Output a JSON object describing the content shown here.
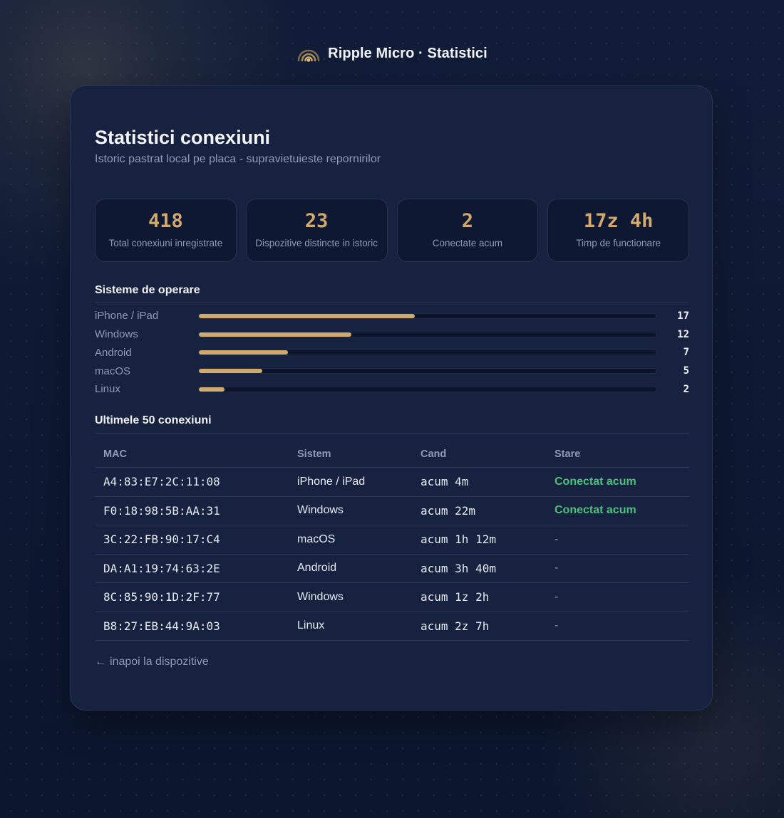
{
  "brand": {
    "title": "Ripple Micro · Statistici",
    "icon": "signal-waves-icon",
    "accent": "#d2ab6c"
  },
  "page": {
    "title": "Statistici conexiuni",
    "subtitle": "Istoric pastrat local pe placa - supravietuieste repornirilor"
  },
  "stats": [
    {
      "value": "418",
      "label": "Total conexiuni inregistrate"
    },
    {
      "value": "23",
      "label": "Dispozitive distincte in istoric"
    },
    {
      "value": "2",
      "label": "Conectate acum"
    },
    {
      "value": "17z 4h",
      "label": "Timp de functionare"
    }
  ],
  "os_section": {
    "title": "Sisteme de operare",
    "max": 36,
    "items": [
      {
        "name": "iPhone / iPad",
        "count": 17
      },
      {
        "name": "Windows",
        "count": 12
      },
      {
        "name": "Android",
        "count": 7
      },
      {
        "name": "macOS",
        "count": 5
      },
      {
        "name": "Linux",
        "count": 2
      }
    ]
  },
  "connections": {
    "title": "Ultimele 50 conexiuni",
    "headers": [
      "MAC",
      "Sistem",
      "Cand",
      "Stare"
    ],
    "rows": [
      {
        "mac": "A4:83:E7:2C:11:08",
        "os": "iPhone / iPad",
        "when": "acum 4m",
        "status": "Conectat acum",
        "online": true
      },
      {
        "mac": "F0:18:98:5B:AA:31",
        "os": "Windows",
        "when": "acum 22m",
        "status": "Conectat acum",
        "online": true
      },
      {
        "mac": "3C:22:FB:90:17:C4",
        "os": "macOS",
        "when": "acum 1h 12m",
        "status": "-",
        "online": false
      },
      {
        "mac": "DA:A1:19:74:63:2E",
        "os": "Android",
        "when": "acum 3h 40m",
        "status": "-",
        "online": false
      },
      {
        "mac": "8C:85:90:1D:2F:77",
        "os": "Windows",
        "when": "acum 1z 2h",
        "status": "-",
        "online": false
      },
      {
        "mac": "B8:27:EB:44:9A:03",
        "os": "Linux",
        "when": "acum 2z 7h",
        "status": "-",
        "online": false
      }
    ]
  },
  "back_link": {
    "arrow": "←",
    "label": "inapoi la dispozitive"
  },
  "colors": {
    "online": "#4fbf7f",
    "muted": "#8f9bb3",
    "bar": "#cfaa6c"
  }
}
